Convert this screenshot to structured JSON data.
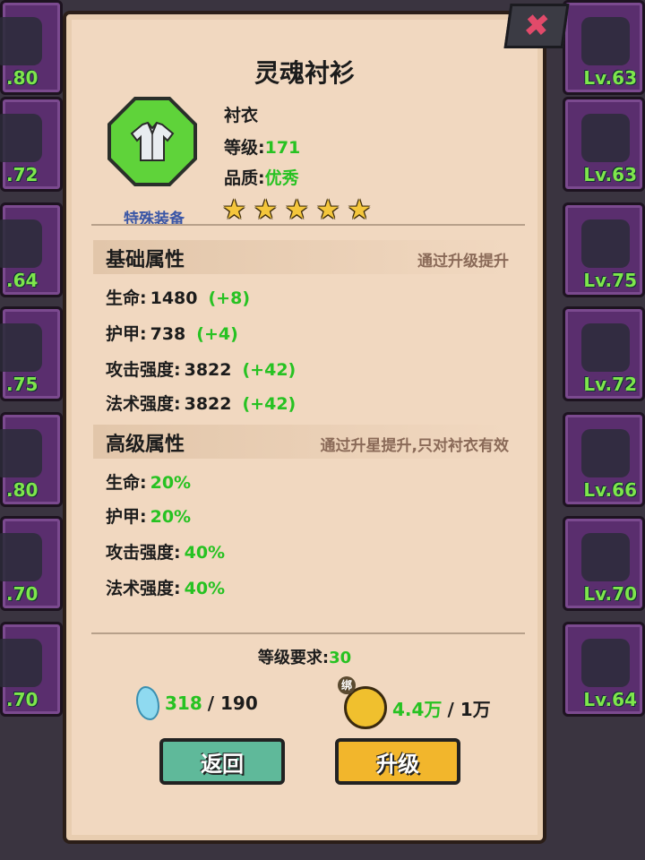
{
  "title": "灵魂衬衫",
  "item": {
    "type": "衬衣",
    "level_label": "等级:",
    "level_value": "171",
    "quality_label": "品质:",
    "quality_value": "优秀",
    "tag": "特殊装备",
    "stars": 5,
    "star_glyph": "★"
  },
  "basic": {
    "heading": "基础属性",
    "note": "通过升级提升",
    "stats": [
      {
        "label": "生命:",
        "value": "1480",
        "plus": "(+8)"
      },
      {
        "label": "护甲:",
        "value": "738",
        "plus": "(+4)"
      },
      {
        "label": "攻击强度:",
        "value": "3822",
        "plus": "(+42)"
      },
      {
        "label": "法术强度:",
        "value": "3822",
        "plus": "(+42)"
      }
    ]
  },
  "advanced": {
    "heading": "高级属性",
    "note": "通过升星提升,只对衬衣有效",
    "stats": [
      {
        "label": "生命:",
        "value": "20%"
      },
      {
        "label": "护甲:",
        "value": "20%"
      },
      {
        "label": "攻击强度:",
        "value": "40%"
      },
      {
        "label": "法术强度:",
        "value": "40%"
      }
    ]
  },
  "requirement": {
    "label": "等级要求:",
    "value": "30"
  },
  "resources": {
    "crystal_have": "318",
    "crystal_need": "/ 190",
    "gold_have": "4.4万",
    "gold_need": "/ 1万",
    "bind_label": "绑"
  },
  "buttons": {
    "back": "返回",
    "upgrade": "升级"
  },
  "close_glyph": "✖",
  "left_levels": [
    ".80",
    ".72",
    ".64",
    ".75",
    ".80",
    ".70",
    ".70"
  ],
  "right_levels": [
    "Lv.63",
    "Lv.63",
    "Lv.75",
    "Lv.72",
    "Lv.66",
    "Lv.70",
    "Lv.64"
  ],
  "colors": {
    "accent_green": "#27c222",
    "panel": "#f1d8c0",
    "slot_purple": "#5a2e6e",
    "back_button": "#5fb99a",
    "upgrade_button": "#f2b62c"
  }
}
